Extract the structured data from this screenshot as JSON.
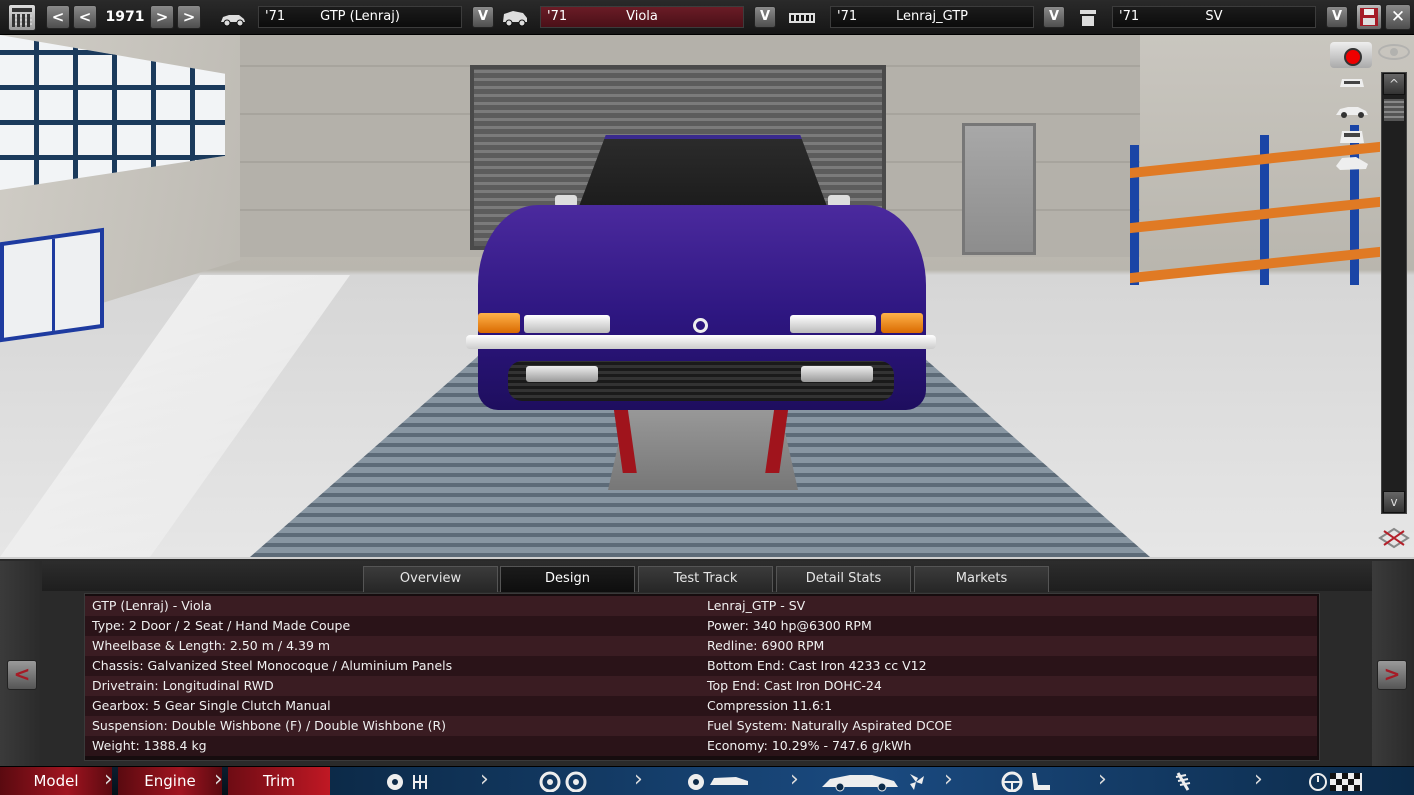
{
  "topbar": {
    "prev_fast_label": "<",
    "prev_label": "<",
    "year": "1971",
    "next_label": ">",
    "next_fast_label": ">",
    "slots": [
      {
        "year": "'71",
        "name": "GTP (Lenraj)",
        "dropdown": "V",
        "icon": "car-model-icon"
      },
      {
        "year": "'71",
        "name": "Viola",
        "dropdown": "V",
        "icon": "car-trim-icon"
      },
      {
        "year": "'71",
        "name": "Lenraj_GTP",
        "dropdown": "V",
        "icon": "engine-family-icon"
      },
      {
        "year": "'71",
        "name": "SV",
        "dropdown": "V",
        "icon": "engine-variant-icon"
      }
    ],
    "close_label": "✕"
  },
  "viewport": {
    "scroll_up": "^",
    "scroll_down": "v"
  },
  "tabs": [
    "Overview",
    "Design",
    "Test Track",
    "Detail Stats",
    "Markets"
  ],
  "active_tab": "Design",
  "nav": {
    "prev": "<",
    "next": ">"
  },
  "info": {
    "left": [
      "GTP (Lenraj) - Viola",
      "Type: 2 Door / 2 Seat / Hand Made Coupe",
      "Wheelbase & Length: 2.50 m / 4.39 m",
      "Chassis: Galvanized Steel Monocoque / Aluminium Panels",
      "Drivetrain: Longitudinal RWD",
      "Gearbox: 5 Gear Single Clutch Manual",
      "Suspension: Double Wishbone (F) / Double Wishbone (R)",
      "Weight: 1388.4 kg"
    ],
    "right": [
      "Lenraj_GTP - SV",
      "Power: 340 hp@6300 RPM",
      "Redline: 6900 RPM",
      "Bottom End: Cast Iron 4233 cc V12",
      "Top End: Cast Iron DOHC-24",
      "Compression 11.6:1",
      "Fuel System: Naturally Aspirated DCOE",
      "Economy: 10.29% - 747.6 g/kWh"
    ]
  },
  "bottom_nav": {
    "model": "Model",
    "engine": "Engine",
    "trim": "Trim"
  },
  "colors": {
    "accent_red": "#a11420",
    "car_paint": "#2d1680",
    "bottom_blue": "#1a4a80"
  }
}
